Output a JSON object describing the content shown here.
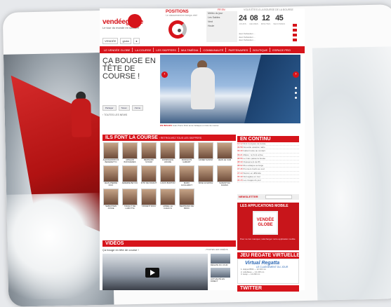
{
  "brand": {
    "logo_text_a": "vendée",
    "logo_text_b": "globe",
    "logo_sub": "Le tour du monde en solitaire",
    "partners": [
      "VENDÉE",
      "globe",
      "●"
    ]
  },
  "header": {
    "positions_title": "POSITIONS",
    "positions_sub": "Le classement en temps réel",
    "langs": "FR  EN",
    "countdown_top": "VOUS ÊTES À LA BOURSE DE LA BOURSE",
    "countdown": [
      {
        "value": "24",
        "label": "JOURS"
      },
      {
        "value": "08",
        "label": "HEURES"
      },
      {
        "value": "12",
        "label": "MINUTES"
      },
      {
        "value": "45",
        "label": "SECONDES"
      }
    ],
    "weather": [
      "Météo du jour",
      "Les Sables",
      "Vent",
      "Houle"
    ],
    "news_mini": [
      "Jean Sébastien ... ",
      "Jean Sébastien ... ",
      "Jean Sébastien ... "
    ]
  },
  "nav": {
    "items": [
      "LE VENDÉE GLOBE",
      "LA COURSE",
      "LES SKIPPERS",
      "MULTIMÉDIA",
      "COMMUNAUTÉ",
      "PARTENAIRES",
      "BOUTIQUE",
      "ESPACE PRO"
    ]
  },
  "hero": {
    "title": "ÇA BOUGE EN TÊTE DE COURSE !",
    "share": [
      "Partager",
      "Tweet",
      "J'aime"
    ],
    "more_news": "› TOUTES LES NEWS",
    "caption_prefix": "EN IMAGES",
    "caption": "Jean-Pierre Dick tente l'attaque en tête de course"
  },
  "skippers": {
    "heading": "ILS FONT LA COURSE",
    "heading_sub": "› RETROUVEZ TOUS LES SKIPPERS",
    "people": [
      [
        "ALESSANDRO DI BENEDETTO",
        "ARNAUD BOISSIÈRES",
        "BERNARD STAMM",
        "DOMINIQUE WAVRE",
        "FRANÇOIS GABART",
        "JAVIER SANSO",
        "JEAN LE CAM"
      ],
      [
        "JEAN-PIERRE DICK",
        "JÉRÉMIE BEYOU",
        "KITO DE PAVANT",
        "LOUIS BURTON",
        "MARC GUILLEMOT",
        "MIKE GOLDING",
        "SAMANTHA DAVIES"
      ],
      [
        "SÉBASTIEN JOSSE",
        "TANGUY DE LAMOTTE",
        "VINCENT RIOU",
        "ARMEL LE CLÉAC'H",
        "BERTRAND DE BROC"
      ]
    ]
  },
  "continu": {
    "heading": "EN CONTINU",
    "items": [
      {
        "time": "10:12",
        "text": "Dick s'empare de la tête"
      },
      {
        "time": "09:58",
        "text": "Nouvelle vacation radio"
      },
      {
        "time": "09:40",
        "text": "Gabart reste au contact"
      },
      {
        "time": "09:21",
        "text": "Météo : le front arrive"
      },
      {
        "time": "08:55",
        "text": "Le Cam passe la bouée"
      },
      {
        "time": "08:30",
        "text": "Classement de 8h"
      },
      {
        "time": "08:02",
        "text": "Riou attaque au large"
      },
      {
        "time": "07:45",
        "text": "Premiers bords au sud"
      },
      {
        "time": "07:10",
        "text": "Stamm en difficulté"
      },
      {
        "time": "06:40",
        "text": "Nuit agitée en mer"
      },
      {
        "time": "06:15",
        "text": "Les images du jour"
      }
    ]
  },
  "newsletter": {
    "label": "NEWSLETTER"
  },
  "apps": {
    "heading": "LES APPLICATIONS MOBILE",
    "logo": "VENDÉE GLOBE",
    "text": "Pour ne rien manquer, téléchargez notre application mobile"
  },
  "regatta": {
    "heading": "JEU RÉGATE VIRTUELLE",
    "logo": "Virtual Regatta",
    "sub": "LE CLASSEMENT DU JOUR",
    "lines": [
      "1. skipper0502 — 12 200 mn",
      "2. voilebleue — 12 215 mn",
      "3. lecap — 12 230 mn"
    ]
  },
  "twitter": {
    "heading": "TWITTER"
  },
  "videos": {
    "heading": "VIDÉOS",
    "title": "Ça bouge en tête de course !",
    "link": "› TOUTES LES VIDÉOS",
    "thumbs": [
      "RÉGATE DU JOUR",
      "ACTUALITÉ EN DIRECT"
    ]
  }
}
